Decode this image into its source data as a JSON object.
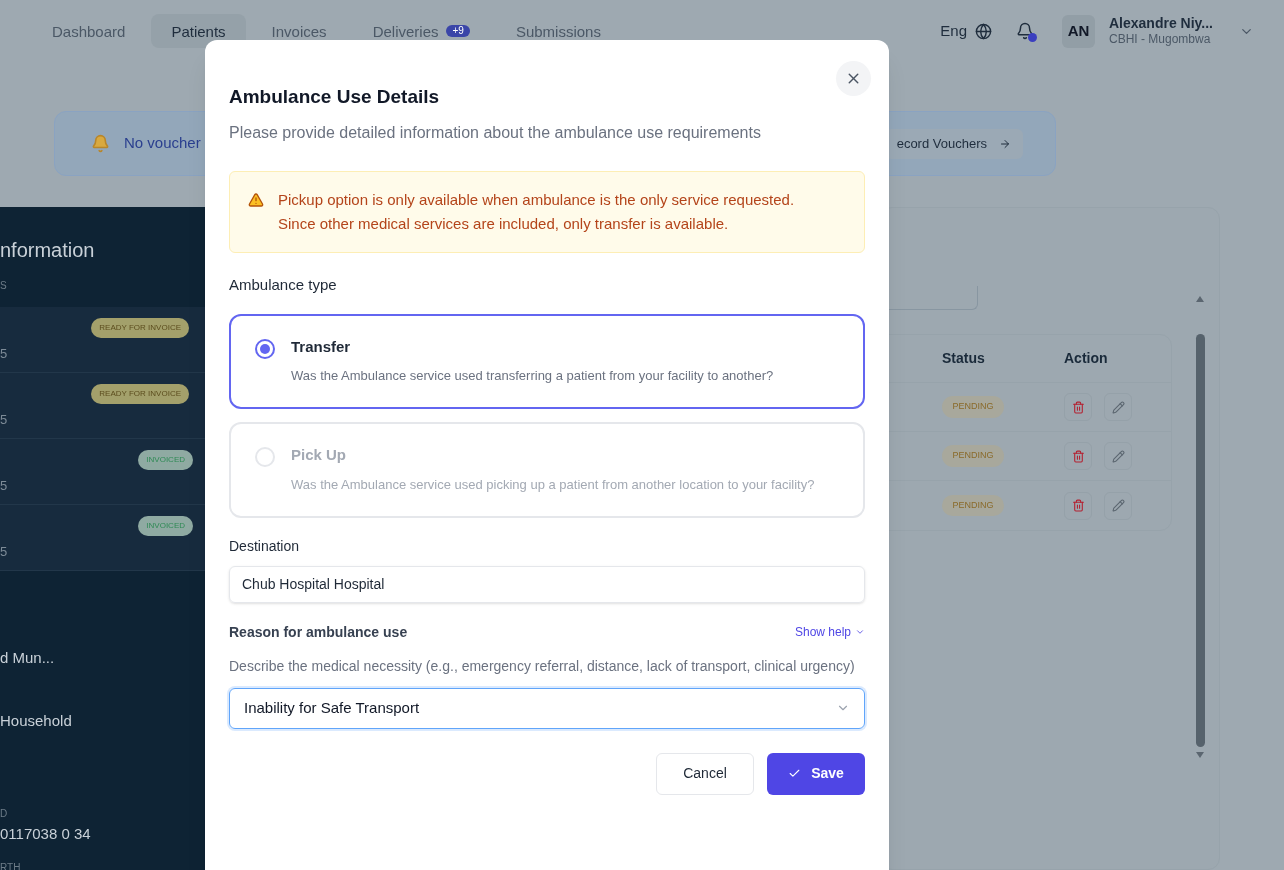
{
  "nav": {
    "tabs": [
      {
        "label": "Dashboard",
        "selected": false
      },
      {
        "label": "Patients",
        "selected": true
      },
      {
        "label": "Invoices",
        "selected": false
      },
      {
        "label": "Deliveries",
        "selected": false,
        "badge": "+9"
      },
      {
        "label": "Submissions",
        "selected": false
      }
    ],
    "language": "Eng",
    "notification_dot": true,
    "user": {
      "initials": "AN",
      "name": "Alexandre Niy...",
      "org": "CBHI - Mugombwa"
    }
  },
  "banner": {
    "text": "No voucher",
    "button": "ecord Vouchers"
  },
  "left_panel": {
    "title": "nformation",
    "label": "S",
    "rows": [
      {
        "date": "5",
        "status": "READY FOR INVOICE",
        "kind": "ready"
      },
      {
        "date": "5",
        "status": "READY FOR INVOICE",
        "kind": "ready"
      },
      {
        "date": "5",
        "status": "INVOICED",
        "kind": "invoiced"
      },
      {
        "date": "5",
        "status": "INVOICED",
        "kind": "invoiced"
      }
    ],
    "fields": [
      {
        "value": "d Mun..."
      },
      {
        "value": "Household"
      },
      {
        "label": "D",
        "value": "0117038 0 34"
      },
      {
        "label": "RTH"
      }
    ]
  },
  "table": {
    "columns": [
      "Status",
      "Action"
    ],
    "rows": [
      {
        "status": "PENDING"
      },
      {
        "status": "PENDING"
      },
      {
        "status": "PENDING"
      }
    ]
  },
  "modal": {
    "title": "Ambulance Use Details",
    "subtitle": "Please provide detailed information about the ambulance use requirements",
    "warning": [
      "Pickup option is only available when ambulance is the only service requested.",
      "Since other medical services are included, only transfer is available."
    ],
    "type_label": "Ambulance type",
    "options": [
      {
        "title": "Transfer",
        "description": "Was the Ambulance service used transferring a patient from your facility to another?",
        "selected": true,
        "disabled": false
      },
      {
        "title": "Pick Up",
        "description": "Was the Ambulance service used picking up a patient from another location to your facility?",
        "selected": false,
        "disabled": true
      }
    ],
    "destination": {
      "label": "Destination",
      "value": "Chub Hospital Hospital"
    },
    "reason": {
      "label": "Reason for ambulance use",
      "help_link": "Show help",
      "hint": "Describe the medical necessity (e.g., emergency referral, distance, lack of transport, clinical urgency)",
      "value": "Inability for Safe Transport"
    },
    "cancel": "Cancel",
    "save": "Save"
  }
}
